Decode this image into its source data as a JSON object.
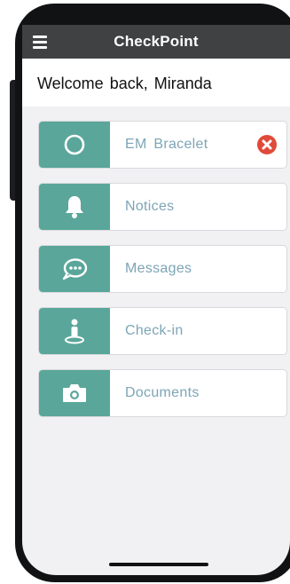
{
  "app": {
    "title": "CheckPoint",
    "menu_icon": "hamburger-menu-icon"
  },
  "welcome": {
    "text": "Welcome back, Miranda"
  },
  "colors": {
    "accent": "#5aa69a",
    "topbar": "#404143",
    "label": "#7da5b6",
    "error": "#e04a3a"
  },
  "menu_items": [
    {
      "label": "EM Bracelet",
      "icon": "circle-ring-icon",
      "status": "error",
      "status_icon": "error-x-icon"
    },
    {
      "label": "Notices",
      "icon": "bell-icon"
    },
    {
      "label": "Messages",
      "icon": "chat-bubble-icon"
    },
    {
      "label": "Check-in",
      "icon": "person-location-icon"
    },
    {
      "label": "Documents",
      "icon": "camera-icon"
    }
  ]
}
